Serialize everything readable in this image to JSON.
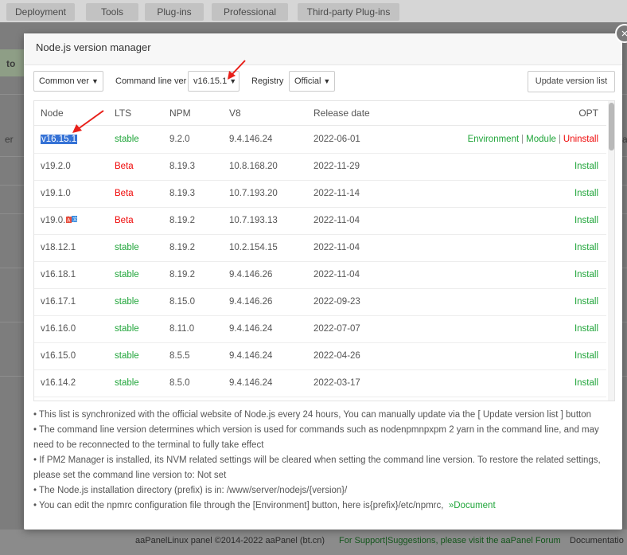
{
  "background": {
    "tabs": [
      "Deployment",
      "Tools",
      "Plug-ins",
      "Professional",
      "Third-party Plug-ins"
    ],
    "left_fragments": [
      "to",
      "er"
    ],
    "right_fragment": "a",
    "footer": {
      "copyright": "aaPanelLinux panel ©2014-2022 aaPanel (bt.cn)",
      "support": "For Support|Suggestions, please visit the aaPanel Forum",
      "docs": "Documentatio"
    }
  },
  "dialog": {
    "title": "Node.js version manager",
    "close_symbol": "×",
    "controls": {
      "common_select": "Common ver",
      "command_label": "Command line ver",
      "command_select": "v16.15.1",
      "registry_label": "Registry",
      "registry_select": "Official",
      "update_button": "Update version list"
    },
    "table": {
      "headers": [
        "Node",
        "LTS",
        "NPM",
        "V8",
        "Release date",
        "OPT"
      ],
      "rows": [
        {
          "node": "v16.15.1",
          "lts": "stable",
          "npm": "9.2.0",
          "v8": "9.4.146.24",
          "date": "2022-06-01",
          "installed": true
        },
        {
          "node": "v19.2.0",
          "lts": "Beta",
          "npm": "8.19.3",
          "v8": "10.8.168.20",
          "date": "2022-11-29",
          "installed": false
        },
        {
          "node": "v19.1.0",
          "lts": "Beta",
          "npm": "8.19.3",
          "v8": "10.7.193.20",
          "date": "2022-11-14",
          "installed": false
        },
        {
          "node": "v19.0.1",
          "lts": "Beta",
          "npm": "8.19.2",
          "v8": "10.7.193.13",
          "date": "2022-11-04",
          "installed": false
        },
        {
          "node": "v18.12.1",
          "lts": "stable",
          "npm": "8.19.2",
          "v8": "10.2.154.15",
          "date": "2022-11-04",
          "installed": false
        },
        {
          "node": "v16.18.1",
          "lts": "stable",
          "npm": "8.19.2",
          "v8": "9.4.146.26",
          "date": "2022-11-04",
          "installed": false
        },
        {
          "node": "v16.17.1",
          "lts": "stable",
          "npm": "8.15.0",
          "v8": "9.4.146.26",
          "date": "2022-09-23",
          "installed": false
        },
        {
          "node": "v16.16.0",
          "lts": "stable",
          "npm": "8.11.0",
          "v8": "9.4.146.24",
          "date": "2022-07-07",
          "installed": false
        },
        {
          "node": "v16.15.0",
          "lts": "stable",
          "npm": "8.5.5",
          "v8": "9.4.146.24",
          "date": "2022-04-26",
          "installed": false
        },
        {
          "node": "v16.14.2",
          "lts": "stable",
          "npm": "8.5.0",
          "v8": "9.4.146.24",
          "date": "2022-03-17",
          "installed": false
        }
      ],
      "opt_links": {
        "environment": "Environment",
        "module": "Module",
        "uninstall": "Uninstall",
        "separator": "|",
        "install": "Install"
      }
    },
    "notes": [
      "• This list is synchronized with the official website of Node.js every 24 hours, You can manually update via the [ Update version list ] button",
      "• The command line version determines which version is used for commands such as nodenpmnpxpm 2 yarn in the command line, and may need to be reconnected to the terminal to fully take effect",
      "• If PM2 Manager is installed, its NVM related settings will be cleared when setting the command line version. To restore the related settings, please set the command line version to: Not set",
      "• The Node.js installation directory (prefix) is in: /www/server/nodejs/{version}/",
      "• You can edit the npmrc configuration file through the [Environment] button, here is{prefix}/etc/npmrc,"
    ],
    "doc_link": "»Document"
  },
  "colors": {
    "green": "#20a53a",
    "red": "#ef0808",
    "selection": "#3572d6",
    "annotation_arrow": "#e8201a"
  }
}
